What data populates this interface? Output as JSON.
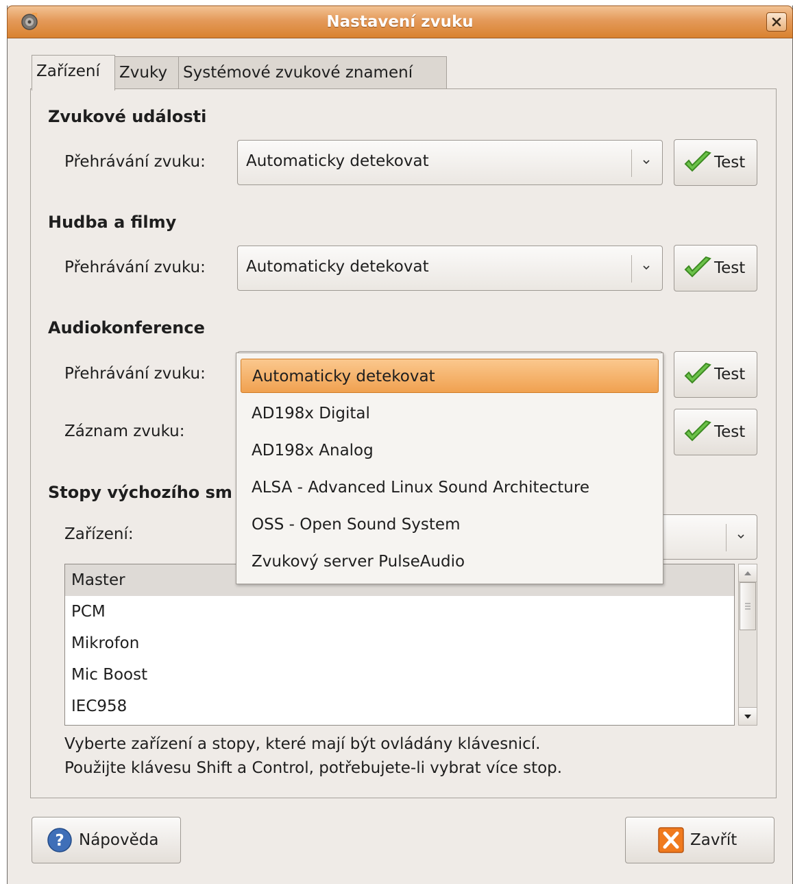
{
  "window": {
    "title": "Nastavení zvuku",
    "app_icon": "sound-settings-icon",
    "close_icon": "close-icon",
    "accent_color": "#e49a5a"
  },
  "tabs": [
    {
      "label": "Zařízení",
      "active": true
    },
    {
      "label": "Zvuky",
      "active": false
    },
    {
      "label": "Systémové zvukové znamení",
      "active": false
    }
  ],
  "sections": {
    "sound_events": {
      "title": "Zvukové události",
      "playback_label": "Přehrávání zvuku:",
      "playback_value": "Automaticky detekovat",
      "test_label": "Test"
    },
    "music_movies": {
      "title": "Hudba a filmy",
      "playback_label": "Přehrávání zvuku:",
      "playback_value": "Automaticky detekovat",
      "test_label": "Test"
    },
    "audio_conference": {
      "title": "Audiokonference",
      "playback_label": "Přehrávání zvuku:",
      "playback_test_label": "Test",
      "record_label": "Záznam zvuku:",
      "record_test_label": "Test"
    },
    "default_mixer": {
      "title": "Stopy výchozího sm",
      "device_label": "Zařízení:",
      "tracks": [
        "Master",
        "PCM",
        "Mikrofon",
        "Mic Boost",
        "IEC958"
      ],
      "selected_track": "Master",
      "help_line1": "Vyberte zařízení a stopy, které mají být ovládány klávesnicí.",
      "help_line2": "Použijte klávesu Shift a Control, potřebujete-li vybrat více stop."
    }
  },
  "dropdown_popup": {
    "options": [
      "Automaticky detekovat",
      "AD198x Digital",
      "AD198x Analog",
      "ALSA - Advanced Linux Sound Architecture",
      "OSS - Open Sound System",
      "Zvukový server PulseAudio"
    ],
    "highlighted": "Automaticky detekovat",
    "highlight_color": "#f0a150"
  },
  "footer": {
    "help_label": "Nápověda",
    "help_icon": "help-icon",
    "close_label": "Zavřít",
    "close_icon": "close-x-icon"
  }
}
